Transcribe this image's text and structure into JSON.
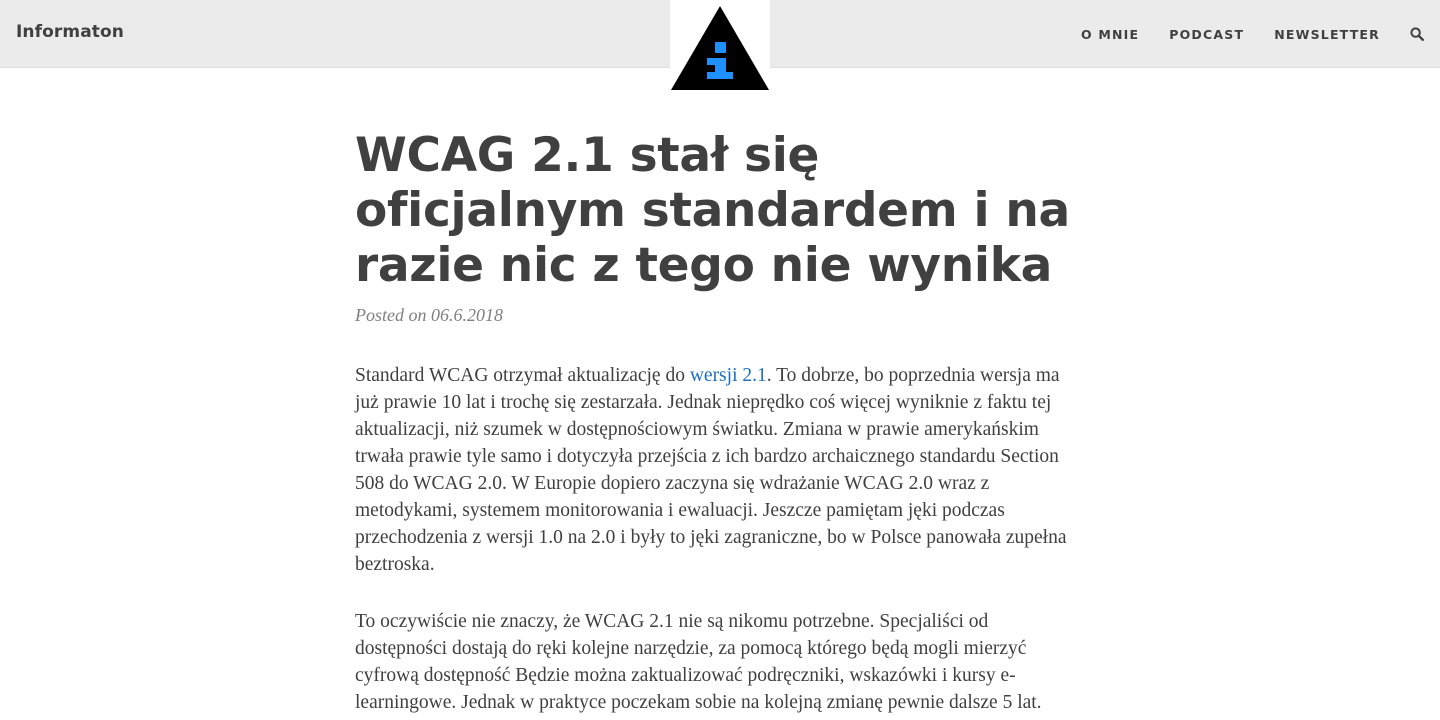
{
  "header": {
    "brand": "Informaton",
    "nav": [
      {
        "label": "O MNIE"
      },
      {
        "label": "PODCAST"
      },
      {
        "label": "NEWSLETTER"
      }
    ],
    "search_icon": "search-icon",
    "logo_icon": "info-triangle-icon",
    "logo_colors": {
      "triangle": "#000000",
      "letter": "#1e90ff"
    }
  },
  "post": {
    "title": "WCAG 2.1 stał się oficjalnym standardem i na razie nic z tego nie wynika",
    "meta": "Posted on 06.6.2018",
    "p1_before": "Standard WCAG otrzymał aktualizację do ",
    "p1_link": "wersji 2.1",
    "p1_after": ". To dobrze, bo poprzednia wersja ma już prawie 10 lat i trochę się zestarzała. Jednak nieprędko coś więcej wyniknie z faktu tej aktualizacji, niż szumek w dostępnościowym światku. Zmiana w prawie amerykańskim trwała prawie tyle samo i dotyczyła przejścia z ich bardzo archaicznego standardu Section 508 do WCAG 2.0. W Europie dopiero zaczyna się wdrażanie WCAG 2.0 wraz z metodykami, systemem monitorowania i ewaluacji. Jeszcze pamiętam jęki podczas przechodzenia z wersji 1.0 na 2.0 i były to jęki zagraniczne, bo w Polsce panowała zupełna beztroska.",
    "p2": "To oczywiście nie znaczy, że WCAG 2.1 nie są nikomu potrzebne. Specjaliści od dostępności dostają do ręki kolejne narzędzie, za pomocą którego będą mogli mierzyć cyfrową dostępność Będzie można zaktualizować podręczniki, wskazówki i kursy e-learningowe. Jednak w praktyce poczekam sobie na kolejną zmianę pewnie dalsze 5 lat."
  },
  "colors": {
    "header_bg": "#ebebeb",
    "text": "#404040",
    "meta": "#808080",
    "link": "#1a6fc2"
  }
}
